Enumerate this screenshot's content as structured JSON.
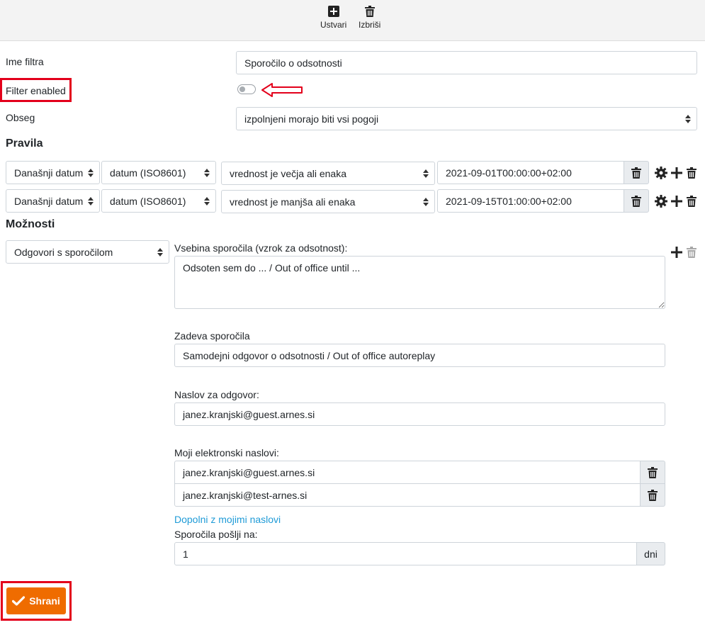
{
  "toolbar": {
    "create_label": "Ustvari",
    "delete_label": "Izbriši"
  },
  "form": {
    "filter_name_label": "Ime filtra",
    "filter_name_value": "Sporočilo o odsotnosti",
    "filter_enabled_label": "Filter enabled",
    "filter_enabled": false,
    "scope_label": "Obseg",
    "scope_value": "izpolnjeni morajo biti vsi pogoji"
  },
  "rules": {
    "heading": "Pravila",
    "items": [
      {
        "field": "Današnji datum",
        "type": "datum (ISO8601)",
        "operator": "vrednost je večja ali enaka",
        "value": "2021-09-01T00:00:00+02:00"
      },
      {
        "field": "Današnji datum",
        "type": "datum (ISO8601)",
        "operator": "vrednost je manjša ali enaka",
        "value": "2021-09-15T01:00:00+02:00"
      }
    ]
  },
  "options": {
    "heading": "Možnosti",
    "action_value": "Odgovori s sporočilom",
    "body_label": "Vsebina sporočila (vzrok za odsotnost):",
    "body_value": "Odsoten sem do ... / Out of office until ...",
    "subject_label": "Zadeva sporočila",
    "subject_value": "Samodejni odgovor o odsotnosti / Out of office autoreplay",
    "reply_to_label": "Naslov za odgovor:",
    "reply_to_value": "janez.kranjski@guest.arnes.si",
    "my_addresses_label": "Moji elektronski naslovi:",
    "my_addresses": [
      "janez.kranjski@guest.arnes.si",
      "janez.kranjski@test-arnes.si"
    ],
    "fill_link": "Dopolni z mojimi naslovi",
    "send_every_label": "Sporočila pošlji na:",
    "send_every_value": "1",
    "send_every_unit": "dni"
  },
  "actions": {
    "save_label": "Shrani"
  },
  "colors": {
    "accent": "#ef6c00",
    "highlight": "#e3001b",
    "link": "#1f9bd7"
  }
}
